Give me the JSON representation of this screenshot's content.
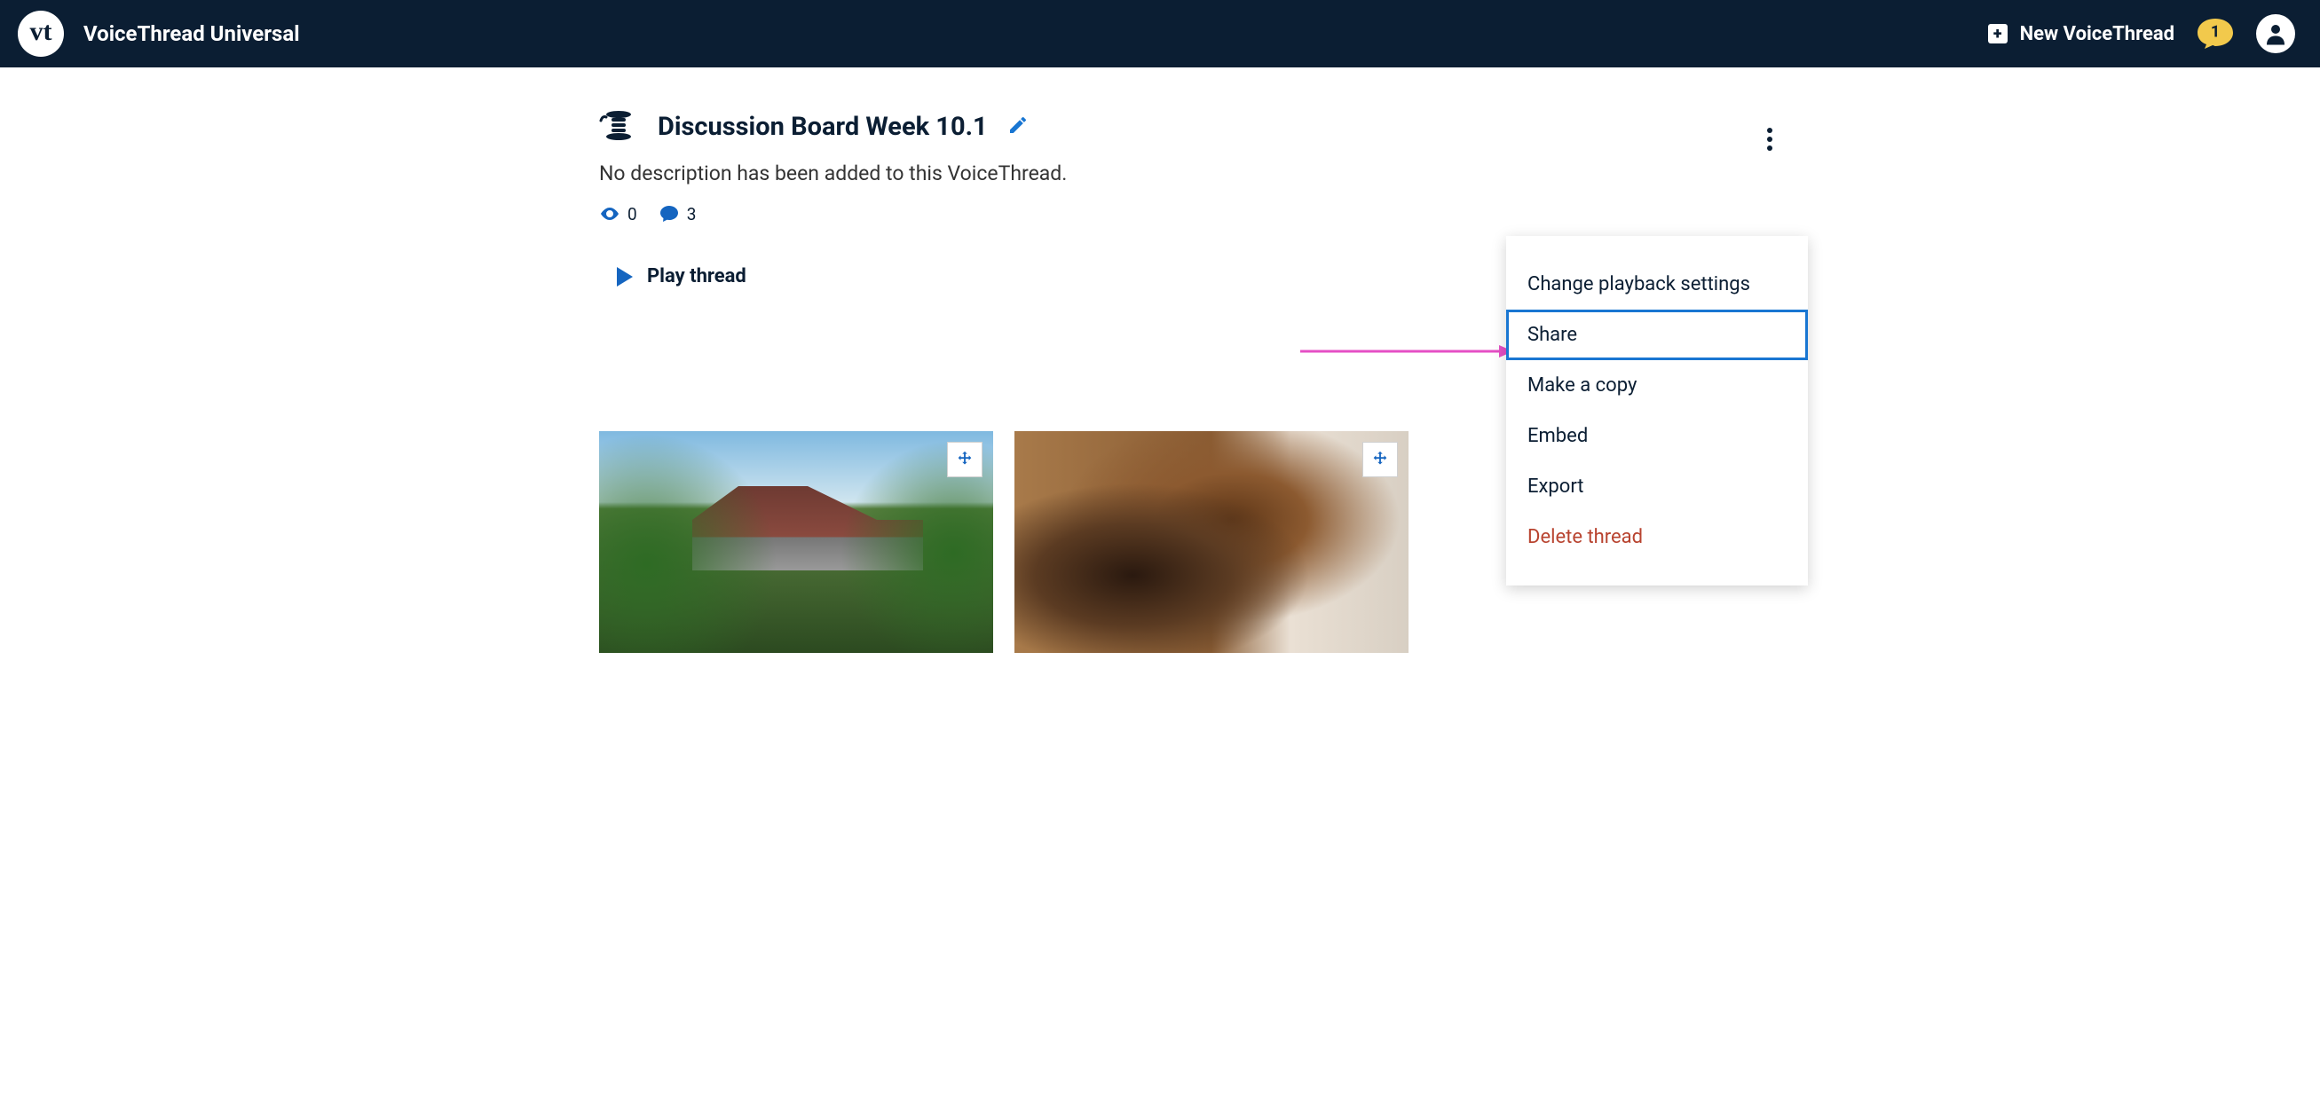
{
  "header": {
    "logo_text": "vt",
    "app_name": "VoiceThread Universal",
    "new_label": "New VoiceThread",
    "notif_count": "1"
  },
  "thread": {
    "title": "Discussion Board Week 10.1",
    "description": "No description has been added to this VoiceThread.",
    "views": "0",
    "comments": "3",
    "play_label": "Play thread"
  },
  "menu": {
    "items": [
      {
        "label": "Change playback settings",
        "highlighted": false,
        "danger": false
      },
      {
        "label": "Share",
        "highlighted": true,
        "danger": false
      },
      {
        "label": "Make a copy",
        "highlighted": false,
        "danger": false
      },
      {
        "label": "Embed",
        "highlighted": false,
        "danger": false
      },
      {
        "label": "Export",
        "highlighted": false,
        "danger": false
      },
      {
        "label": "Delete thread",
        "highlighted": false,
        "danger": true
      }
    ]
  }
}
